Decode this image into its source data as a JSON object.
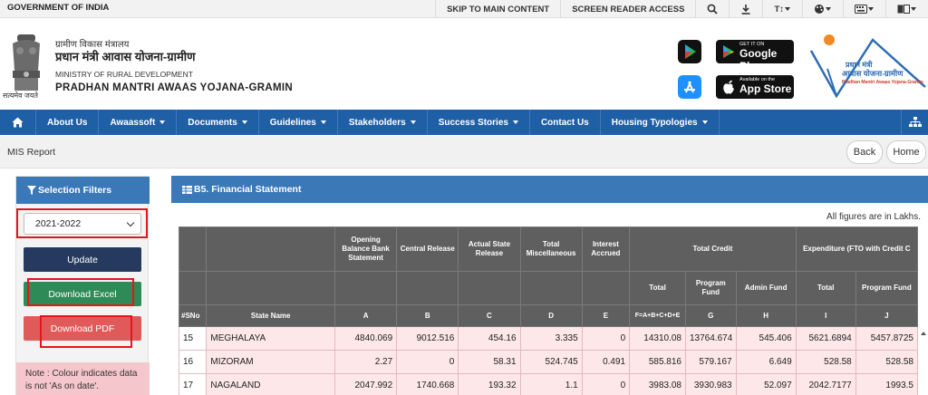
{
  "gov_bar": {
    "title": "GOVERNMENT OF INDIA",
    "skip_link": "SKIP TO MAIN CONTENT",
    "screen_reader": "SCREEN READER ACCESS",
    "text_size": "T↕"
  },
  "header": {
    "ministry_hi": "ग्रामीण विकास मंत्रालय",
    "pmay_hi": "प्रधान मंत्री आवास योजना-ग्रामीण",
    "ministry_en": "MINISTRY OF RURAL DEVELOPMENT",
    "pmay_en": "PRADHAN MANTRI AWAAS YOJANA-GRAMIN",
    "emblem_motto": "सत्यमेव जयते",
    "google_play_small": "GET IT ON",
    "google_play_big": "Google Play",
    "app_store_small": "Available on the",
    "app_store_big": "App Store",
    "logo_hi_1": "प्रधान मंत्री",
    "logo_hi_2": "आवास योजना-ग्रामीण",
    "logo_en": "Pradhan Mantri Awaas Yojana-Gramin"
  },
  "nav": {
    "items": [
      "About Us",
      "Awaassoft",
      "Documents",
      "Guidelines",
      "Stakeholders",
      "Success Stories",
      "Contact Us",
      "Housing Typologies"
    ]
  },
  "mis": {
    "title": "MIS Report",
    "back": "Back",
    "home": "Home"
  },
  "sidebar": {
    "title": "Selection Filters",
    "year": "2021-2022",
    "update": "Update",
    "download_excel": "Download Excel",
    "download_pdf": "Download PDF",
    "note": "Note : Colour indicates data is not 'As on date'."
  },
  "panel": {
    "title": "B5. Financial Statement",
    "lakhs_note": "All figures are in Lakhs."
  },
  "table": {
    "group_headers": {
      "opening": "Opening Balance Bank Statement",
      "central": "Central Release",
      "actual_state": "Actual State Release",
      "total_misc": "Total Miscellaneous",
      "interest": "Interest Accrued",
      "total_credit": "Total Credit",
      "expenditure": "Expenditure (FTO with Credit C"
    },
    "sub_headers": {
      "total": "Total",
      "program_fund": "Program Fund",
      "admin_fund": "Admin Fund",
      "exp_total": "Total",
      "exp_program_fund": "Program Fund"
    },
    "code_headers": {
      "sno": "#SNo",
      "state": "State Name",
      "a": "A",
      "b": "B",
      "c": "C",
      "d": "D",
      "e": "E",
      "f": "F=A+B+C+D+E",
      "g": "G",
      "h": "H",
      "i": "I",
      "j": "J"
    },
    "rows": [
      {
        "sno": "15",
        "state": "MEGHALAYA",
        "a": "4840.069",
        "b": "9012.516",
        "c": "454.16",
        "d": "3.335",
        "e": "0",
        "f": "14310.08",
        "g": "13764.674",
        "h": "545.406",
        "i": "5621.6894",
        "j": "5457.8725"
      },
      {
        "sno": "16",
        "state": "MIZORAM",
        "a": "2.27",
        "b": "0",
        "c": "58.31",
        "d": "524.745",
        "e": "0.491",
        "f": "585.816",
        "g": "579.167",
        "h": "6.649",
        "i": "528.58",
        "j": "528.58"
      },
      {
        "sno": "17",
        "state": "NAGALAND",
        "a": "2047.992",
        "b": "1740.668",
        "c": "193.32",
        "d": "1.1",
        "e": "0",
        "f": "3983.08",
        "g": "3930.983",
        "h": "52.097",
        "i": "2042.7177",
        "j": "1993.5"
      }
    ]
  },
  "colors": {
    "nav_blue": "#1f5fa6",
    "panel_blue": "#3a78b8",
    "header_gray": "#5f5f5f",
    "row_pink": "#fde7e9",
    "excel_green": "#2e8b57",
    "pdf_red": "#e05a5a",
    "update_navy": "#253a5e",
    "highlight_red": "#e4161c"
  }
}
